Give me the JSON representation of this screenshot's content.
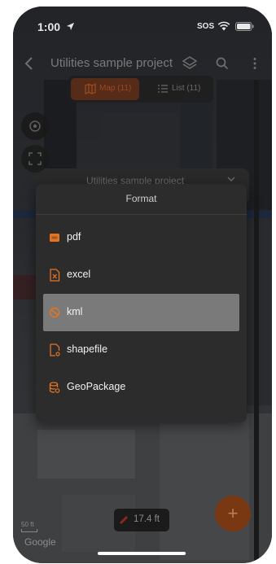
{
  "status_bar": {
    "time": "1:00",
    "sos": "SOS"
  },
  "header": {
    "title": "Utilities sample project"
  },
  "view_toggle": {
    "map_label": "Map (11)",
    "list_label": "List (11)"
  },
  "behind_sheet": {
    "title": "Utilities sample project"
  },
  "format_modal": {
    "title": "Format",
    "options": [
      {
        "label": "pdf",
        "icon": "pdf-file-icon",
        "selected": false
      },
      {
        "label": "excel",
        "icon": "excel-file-icon",
        "selected": false
      },
      {
        "label": "kml",
        "icon": "kml-icon",
        "selected": true
      },
      {
        "label": "shapefile",
        "icon": "shapefile-icon",
        "selected": false
      },
      {
        "label": "GeoPackage",
        "icon": "geopackage-icon",
        "selected": false
      }
    ]
  },
  "map": {
    "distance": "17.4 ft",
    "scale_label": "50 ft",
    "attribution": "Google"
  },
  "colors": {
    "accent": "#e8731f",
    "selected_row": "#7a7a7a",
    "modal_bg": "#2c2c2c"
  }
}
